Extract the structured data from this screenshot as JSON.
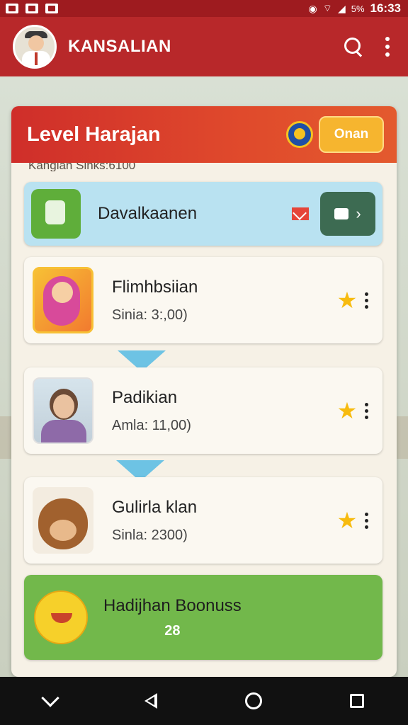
{
  "status_bar": {
    "battery": "5%",
    "time": "16:33"
  },
  "app_bar": {
    "title": "KANSALIAN"
  },
  "level_panel": {
    "title": "Level Harajan",
    "action_button": "Onan",
    "subline": "Kangian Sinks:6100"
  },
  "items": [
    {
      "name": "Davalkaanen",
      "style": "blue"
    },
    {
      "name": "Flimhbsiian",
      "sub": "Sinia: 3:,00)"
    },
    {
      "name": "Padikian",
      "sub": "Amla: 11,00)"
    },
    {
      "name": "Gulirla klan",
      "sub": "Sinla: 2300)"
    }
  ],
  "bonus": {
    "name": "Hadijhan Boonuss",
    "value": "28"
  },
  "colors": {
    "appbar": "#b8282a",
    "panel_header": "#d93a2b",
    "accent_orange": "#f6b52f",
    "bonus_green": "#72b84b",
    "item_blue": "#b9e2f1",
    "star": "#f7bb0f"
  }
}
